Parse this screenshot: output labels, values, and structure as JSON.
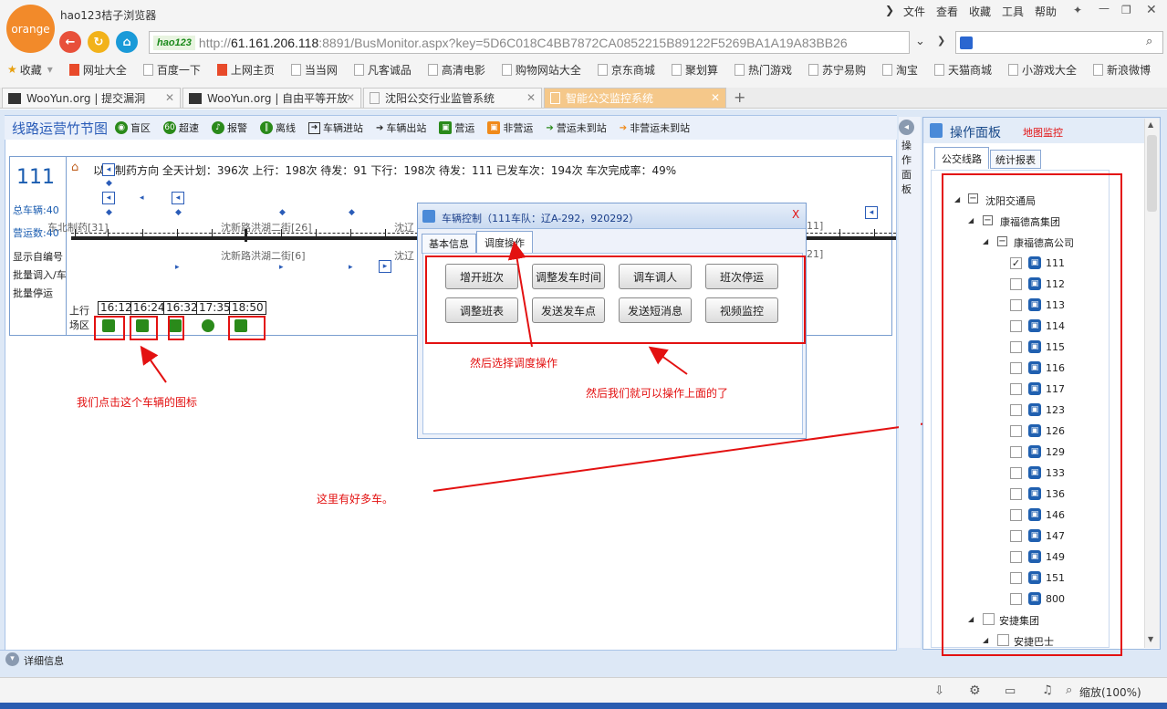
{
  "browser": {
    "logo_text": "orange",
    "app_title": "hao123桔子浏览器",
    "url_logo": "hao123",
    "url_scheme": "http://",
    "url_host": "61.161.206.118",
    "url_rest": ":8891/BusMonitor.aspx?key=5D6C018C4BB7872CA0852215B89122F5269BA1A19A83BB26",
    "menu": [
      "文件",
      "查看",
      "收藏",
      "工具",
      "帮助"
    ],
    "bookmarks": [
      "收藏",
      "网址大全",
      "百度一下",
      "上网主页",
      "当当网",
      "凡客诚品",
      "高清电影",
      "购物网站大全",
      "京东商城",
      "聚划算",
      "热门游戏",
      "苏宁易购",
      "淘宝",
      "天猫商城",
      "小游戏大全",
      "新浪微博"
    ],
    "tabs": [
      "WooYun.org | 提交漏洞",
      "WooYun.org | 自由平等开放",
      "沈阳公交行业监管系统",
      "智能公交监控系统"
    ],
    "zoom": "缩放(100%)"
  },
  "toolbar": {
    "title": "线路运营竹节图",
    "items": [
      "盲区",
      "超速",
      "报警",
      "离线",
      "车辆进站",
      "车辆出站",
      "营运",
      "非营运",
      "营运未到站",
      "非营运未到站"
    ],
    "speed_badge": "60"
  },
  "route": {
    "number": "111",
    "total_label": "总车辆:40",
    "operating_label": "营运数:40",
    "actions": [
      "显示自编号",
      "批量调入/车",
      "批量停运"
    ],
    "stats": "以北制药方向  全天计划：396次  上行：198次 待发：91  下行：198次 待发：111  已发车次：194次   车次完成率：49%",
    "stations_top": [
      "东北制药[31]",
      "沈新路洪湖二街[26]",
      "沈辽",
      "11]"
    ],
    "stations_bottom": [
      "沈新路洪湖二街[6]",
      "沈辽",
      "21]"
    ],
    "depot_up": "上行",
    "depot_area": "场区",
    "times": [
      "16:12",
      "16:24",
      "16:32",
      "17:35",
      "18:50"
    ]
  },
  "dialog": {
    "title": "车辆控制（111车队：辽A-292，920292）",
    "close": "X",
    "tabs": [
      "基本信息",
      "调度操作"
    ],
    "buttons": [
      "增开班次",
      "调整发车时间",
      "调车调人",
      "班次停运",
      "调整班表",
      "发送发车点",
      "发送短消息",
      "视频监控"
    ]
  },
  "annotations": {
    "click_bus": "我们点击这个车辆的图标",
    "select_dispatch": "然后选择调度操作",
    "operate_above": "然后我们就可以操作上面的了",
    "many_buses": "这里有好多车。"
  },
  "side_strip": "操作面板",
  "right_panel": {
    "title": "操作面板",
    "map_link": "地图监控",
    "tabs": [
      "公交线路",
      "统计报表"
    ],
    "tree": {
      "root": "沈阳交通局",
      "group1": "康福德高集团",
      "company1": "康福德高公司",
      "lines": [
        "111",
        "112",
        "113",
        "114",
        "115",
        "116",
        "117",
        "123",
        "126",
        "129",
        "133",
        "136",
        "146",
        "147",
        "149",
        "151",
        "800"
      ],
      "group2": "安捷集团",
      "company2": "安捷巴士"
    }
  },
  "bottom": {
    "detail": "详细信息"
  },
  "colors": {
    "accent_blue": "#2a5cb8",
    "annotation_red": "#e31111",
    "bus_green": "#2a8a1a",
    "active_tab": "#f5c88a"
  }
}
